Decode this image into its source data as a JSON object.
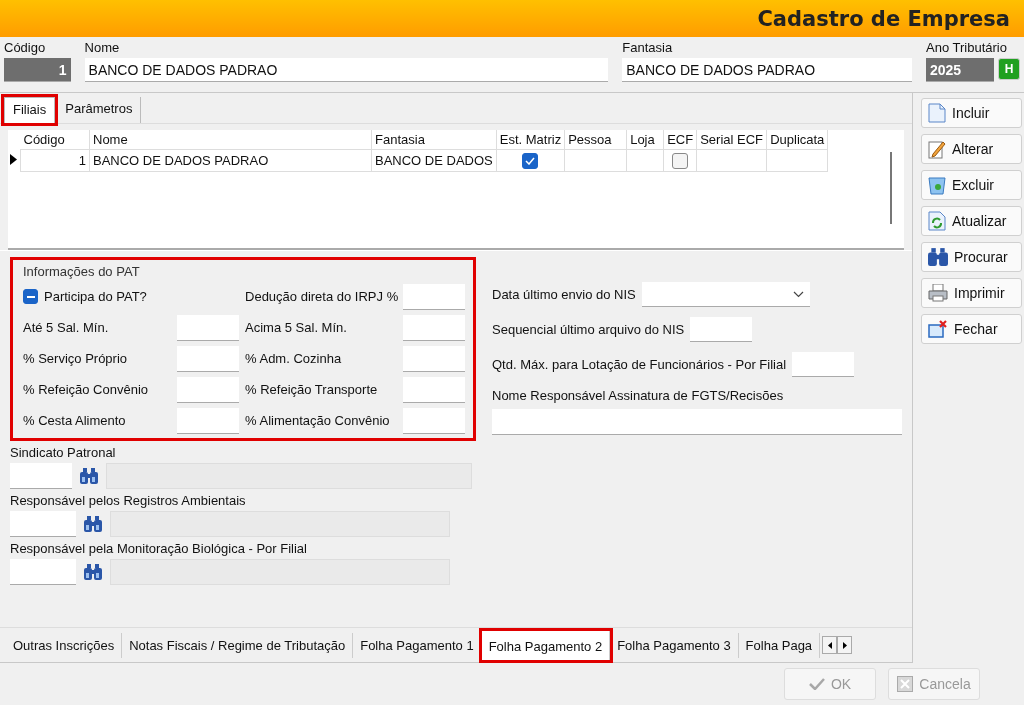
{
  "window": {
    "title": "Cadastro de Empresa"
  },
  "header": {
    "codigo": {
      "label": "Código",
      "value": "1"
    },
    "nome": {
      "label": "Nome",
      "value": "BANCO DE DADOS PADRAO"
    },
    "fantasia": {
      "label": "Fantasia",
      "value": "BANCO DE DADOS PADRAO"
    },
    "ano": {
      "label": "Ano Tributário",
      "value": "2025",
      "button": "H"
    }
  },
  "top_tabs": [
    {
      "label": "Filiais",
      "selected": true,
      "highlighted": true
    },
    {
      "label": "Parâmetros",
      "selected": false,
      "highlighted": false
    }
  ],
  "grid": {
    "columns": [
      "Código",
      "Nome",
      "Fantasia",
      "Est. Matriz",
      "Pessoa",
      "Loja",
      "ECF",
      "Serial ECF",
      "Duplicata"
    ],
    "rows": [
      {
        "current": true,
        "codigo": "1",
        "nome": "BANCO DE DADOS PADRAO",
        "fantasia": "BANCO DE DADOS",
        "est_matriz": true,
        "ecf": false
      }
    ]
  },
  "pat": {
    "title": "Informações do PAT",
    "highlighted": true,
    "participa": {
      "label": "Participa do PAT?",
      "indeterminate": true
    },
    "deducao": "Dedução direta do IRPJ %",
    "rows": [
      [
        "Até 5 Sal. Mín.",
        "Acima 5 Sal. Mín."
      ],
      [
        "% Serviço Próprio",
        "% Adm. Cozinha"
      ],
      [
        "% Refeição Convênio",
        "% Refeição Transporte"
      ],
      [
        "% Cesta Alimento",
        "% Alimentação Convênio"
      ]
    ]
  },
  "lookups": [
    {
      "label": "Sindicato Patronal"
    },
    {
      "label": "Responsável pelos Registros Ambientais"
    },
    {
      "label": "Responsável pela Monitoração Biológica - Por Filial"
    }
  ],
  "nis": {
    "data_envio": "Data último envio do NIS",
    "sequencial": "Sequencial último arquivo do NIS",
    "qtd_max": "Qtd. Máx. para Lotação de Funcionários - Por Filial",
    "nome_resp": "Nome Responsável Assinatura de FGTS/Recisões"
  },
  "side_buttons": [
    {
      "label": "Incluir",
      "kind": "add"
    },
    {
      "label": "Alterar",
      "kind": "edit"
    },
    {
      "label": "Excluir",
      "kind": "delete"
    },
    {
      "label": "Atualizar",
      "kind": "refresh"
    },
    {
      "label": "Procurar",
      "kind": "search"
    },
    {
      "label": "Imprimir",
      "kind": "print"
    },
    {
      "label": "Fechar",
      "kind": "close"
    }
  ],
  "bottom_tabs": [
    {
      "label": "Outras Inscrições",
      "selected": false,
      "highlighted": false
    },
    {
      "label": "Notas Fiscais / Regime de Tributação",
      "selected": false,
      "highlighted": false
    },
    {
      "label": "Folha Pagamento 1",
      "selected": false,
      "highlighted": false
    },
    {
      "label": "Folha Pagamento 2",
      "selected": true,
      "highlighted": true
    },
    {
      "label": "Folha Pagamento 3",
      "selected": false,
      "highlighted": false
    },
    {
      "label": "Folha Paga",
      "selected": false,
      "highlighted": false
    }
  ],
  "footer_buttons": [
    {
      "label": "OK",
      "kind": "confirm",
      "disabled": true
    },
    {
      "label": "Cancela",
      "kind": "cancel",
      "disabled": true
    }
  ]
}
